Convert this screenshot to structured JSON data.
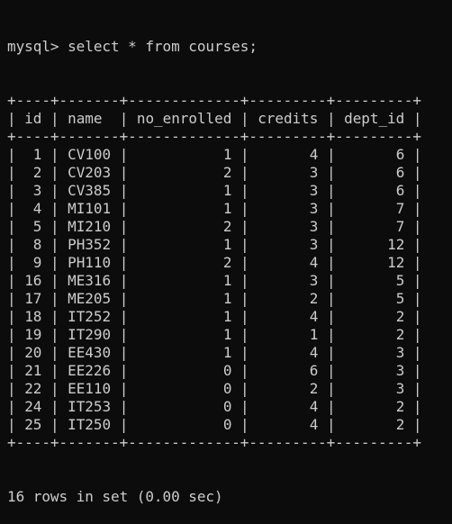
{
  "terminal": {
    "prompt": "mysql> ",
    "command": "select * from courses;",
    "footer": "16 rows in set (0.00 sec)",
    "colors": {
      "background": "#0c0c0c",
      "text": "#cccccc"
    }
  },
  "table": {
    "columns": [
      {
        "label": "id",
        "width": 2,
        "align": "r"
      },
      {
        "label": "name",
        "width": 5,
        "align": "l"
      },
      {
        "label": "no_enrolled",
        "width": 11,
        "align": "r"
      },
      {
        "label": "credits",
        "width": 7,
        "align": "r"
      },
      {
        "label": "dept_id",
        "width": 7,
        "align": "r"
      }
    ],
    "rows": [
      [
        "1",
        "CV100",
        "1",
        "4",
        "6"
      ],
      [
        "2",
        "CV203",
        "2",
        "3",
        "6"
      ],
      [
        "3",
        "CV385",
        "1",
        "3",
        "6"
      ],
      [
        "4",
        "MI101",
        "1",
        "3",
        "7"
      ],
      [
        "5",
        "MI210",
        "2",
        "3",
        "7"
      ],
      [
        "8",
        "PH352",
        "1",
        "3",
        "12"
      ],
      [
        "9",
        "PH110",
        "2",
        "4",
        "12"
      ],
      [
        "16",
        "ME316",
        "1",
        "3",
        "5"
      ],
      [
        "17",
        "ME205",
        "1",
        "2",
        "5"
      ],
      [
        "18",
        "IT252",
        "1",
        "4",
        "2"
      ],
      [
        "19",
        "IT290",
        "1",
        "1",
        "2"
      ],
      [
        "20",
        "EE430",
        "1",
        "4",
        "3"
      ],
      [
        "21",
        "EE226",
        "0",
        "6",
        "3"
      ],
      [
        "22",
        "EE110",
        "0",
        "2",
        "3"
      ],
      [
        "24",
        "IT253",
        "0",
        "4",
        "2"
      ],
      [
        "25",
        "IT250",
        "0",
        "4",
        "2"
      ]
    ]
  }
}
